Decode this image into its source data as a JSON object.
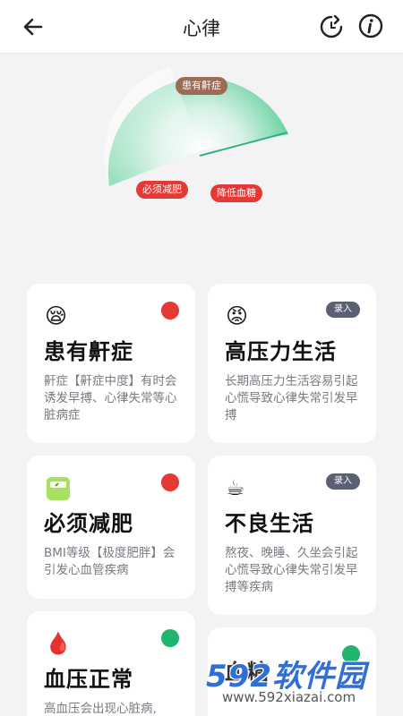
{
  "header": {
    "title": "心律",
    "back_icon": "arrow-left-icon",
    "refresh_icon": "refresh-icon",
    "info_icon": "info-icon"
  },
  "gauge": {
    "tags": [
      "患有鼾症",
      "必须减肥",
      "降低血糖"
    ],
    "colors": {
      "fill_start": "#c8eddc",
      "fill_end": "#3fbf85",
      "line": "#2fb57b"
    }
  },
  "cards": [
    {
      "emoji": "😪",
      "title": "患有鼾症",
      "desc": "鼾症【鼾症中度】有时会诱发早搏、心律失常等心脏病症",
      "indicator": "dot",
      "dot_color": "#e53935"
    },
    {
      "emoji": "😡",
      "title": "高压力生活",
      "desc": "长期高压力生活容易引起心慌导致心律失常引发早搏",
      "indicator": "badge",
      "badge_label": "录入"
    },
    {
      "emoji": "⚖",
      "title": "必须减肥",
      "desc": "BMI等级【极度肥胖】会引发心血管疾病",
      "indicator": "dot",
      "dot_color": "#e53935"
    },
    {
      "emoji": "☕",
      "title": "不良生活",
      "desc": "熬夜、晚睡、久坐会引起心慌导致心律失常引发早搏等疾病",
      "indicator": "badge",
      "badge_label": "录入"
    },
    {
      "emoji": "🩸",
      "title": "血压正常",
      "desc": "高血压会出现心脏病,",
      "indicator": "dot",
      "dot_color": "#1fb56d"
    },
    {
      "emoji": "",
      "title": "血糖",
      "desc": "",
      "indicator": "dot",
      "dot_color": "#1fb56d"
    }
  ],
  "watermark": {
    "brand": "592软件园",
    "url": "www.592xiazai.com"
  }
}
